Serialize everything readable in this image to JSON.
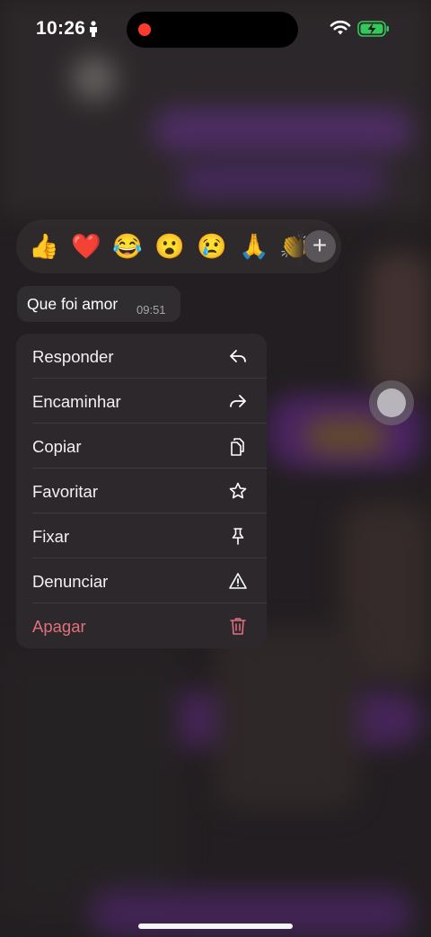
{
  "status_bar": {
    "time": "10:26",
    "icons": [
      "person-icon",
      "wifi-icon",
      "battery-charging-icon"
    ]
  },
  "reactions": {
    "emojis": [
      "👍",
      "❤️",
      "😂",
      "😮",
      "😢",
      "🙏",
      "👏"
    ],
    "add_label": "+"
  },
  "message": {
    "text": "Que foi amor",
    "time": "09:51"
  },
  "context_menu": {
    "items": [
      {
        "label": "Responder",
        "icon": "reply-icon"
      },
      {
        "label": "Encaminhar",
        "icon": "forward-icon"
      },
      {
        "label": "Copiar",
        "icon": "copy-icon"
      },
      {
        "label": "Favoritar",
        "icon": "star-icon"
      },
      {
        "label": "Fixar",
        "icon": "pin-icon"
      },
      {
        "label": "Denunciar",
        "icon": "warning-icon"
      },
      {
        "label": "Apagar",
        "icon": "trash-icon"
      }
    ]
  },
  "colors": {
    "danger": "#e0707e",
    "recording_dot": "#ff3b30",
    "battery_charge": "#34c759",
    "accent_purple": "#7a3aa6"
  }
}
